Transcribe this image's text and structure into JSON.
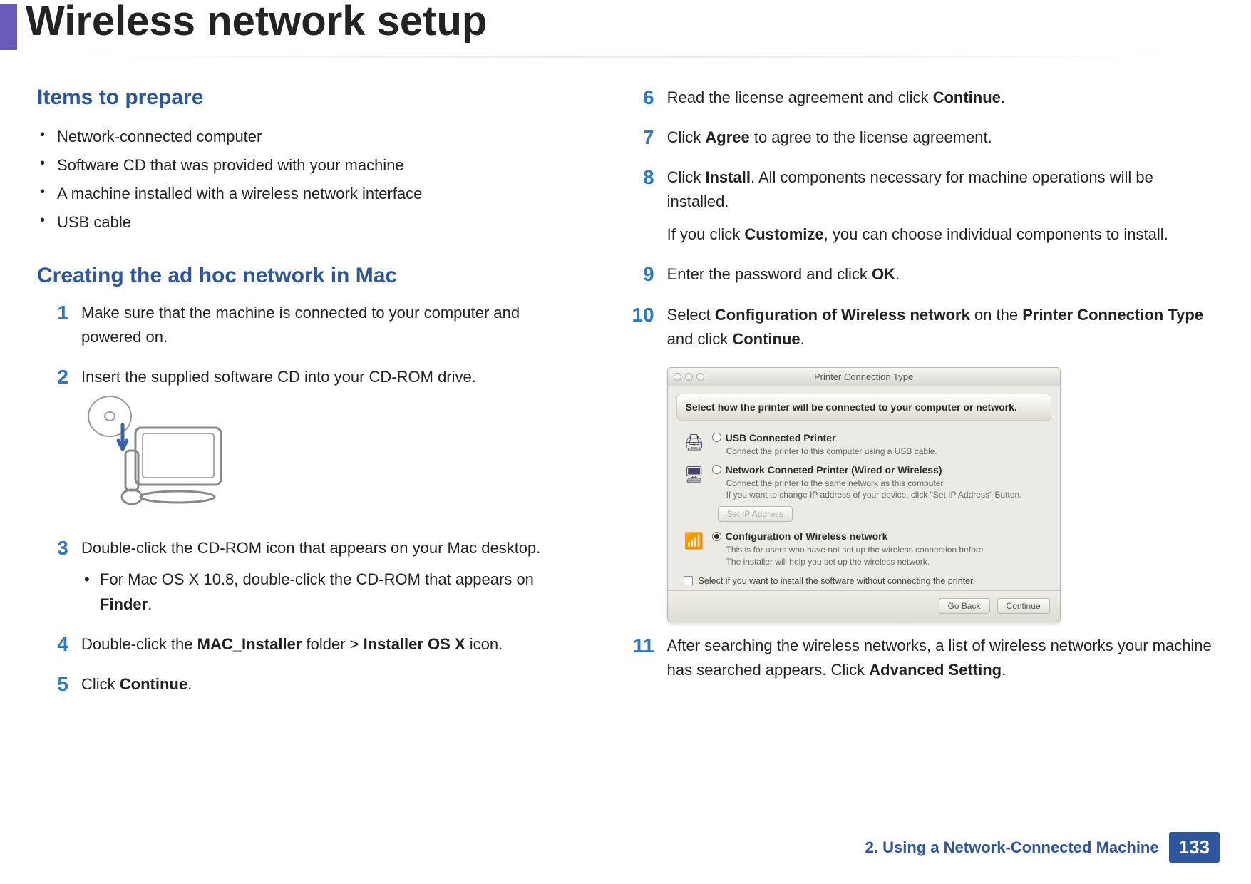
{
  "title": "Wireless network setup",
  "sections": {
    "items_h": "Items to prepare",
    "adhoc_h": "Creating the ad hoc network in Mac"
  },
  "bullets": [
    "Network-connected computer",
    "Software CD that was provided with your machine",
    "A machine installed with a wireless network interface",
    "USB cable"
  ],
  "steps": {
    "s1": {
      "n": "1",
      "t": "Make sure that the machine is connected to your computer and powered on."
    },
    "s2": {
      "n": "2",
      "t": "Insert the supplied software CD into your CD-ROM drive."
    },
    "s3": {
      "n": "3",
      "t": "Double-click the CD-ROM icon that appears on your Mac desktop.",
      "sub_pre": "For Mac OS X 10.8, double-click the CD-ROM that appears on ",
      "sub_b1": "Finder",
      "sub_post": "."
    },
    "s4": {
      "n": "4",
      "pre": "Double-click the ",
      "b1": "MAC_Installer",
      "mid": " folder > ",
      "b2": "Installer OS X",
      "post": " icon."
    },
    "s5": {
      "n": "5",
      "pre": "Click ",
      "b1": "Continue",
      "post": "."
    },
    "s6": {
      "n": "6",
      "pre": "Read the license agreement and click ",
      "b1": "Continue",
      "post": "."
    },
    "s7": {
      "n": "7",
      "pre": "Click ",
      "b1": "Agree",
      "post": " to agree to the license agreement."
    },
    "s8": {
      "n": "8",
      "pre": "Click ",
      "b1": "Install",
      "post": ". All components necessary for machine operations will be installed.",
      "p2_pre": "If you click ",
      "p2_b1": "Customize",
      "p2_post": ", you can choose individual components to install."
    },
    "s9": {
      "n": "9",
      "pre": "Enter the password and click ",
      "b1": "OK",
      "post": "."
    },
    "s10": {
      "n": "10",
      "pre": "Select ",
      "b1": "Configuration of Wireless network",
      "mid": " on the ",
      "b2": "Printer Connection Type",
      "mid2": " and click ",
      "b3": "Continue",
      "post": "."
    },
    "s11": {
      "n": "11",
      "pre": "After searching the wireless networks, a list of wireless networks your machine has searched appears. Click ",
      "b1": "Advanced Setting",
      "post": "."
    }
  },
  "shot": {
    "title": "Printer Connection Type",
    "banner": "Select how the printer will be connected to your computer or network.",
    "opt1_label": "USB Connected Printer",
    "opt1_desc": "Connect the printer to this computer using a USB cable.",
    "opt2_label": "Network Conneted Printer (Wired or Wireless)",
    "opt2_desc": "Connect the printer to the same network as this computer.\nIf you want to change IP address of your device, click \"Set IP Address\" Button.",
    "ip_btn": "Set IP Address",
    "opt3_label": "Configuration of Wireless network",
    "opt3_desc": "This is for users who have not set up the wireless connection before.\nThe installer will help you set up the wireless network.",
    "checkbox": "Select if you want to install the software without connecting the printer.",
    "btn_back": "Go Back",
    "btn_cont": "Continue"
  },
  "footer": {
    "chapter": "2.  Using a Network-Connected Machine",
    "page": "133"
  }
}
